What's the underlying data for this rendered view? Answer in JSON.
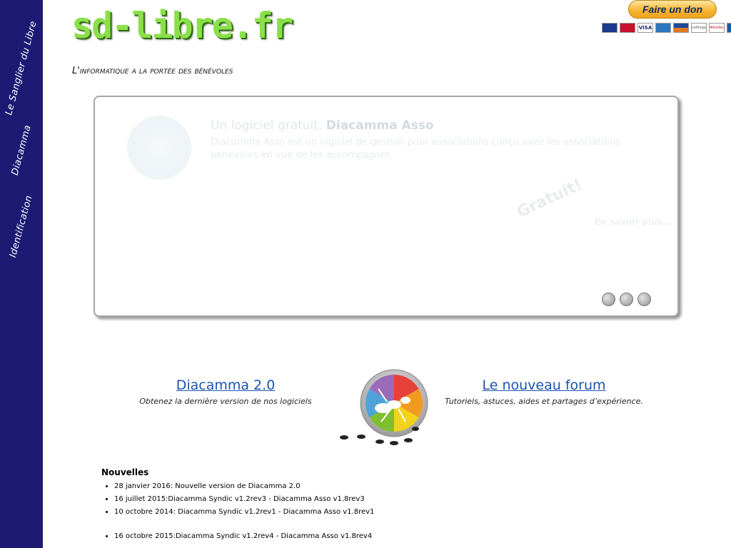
{
  "sidebar": {
    "items": [
      {
        "label": "Le Sanglier du Libre"
      },
      {
        "label": "Diacamma"
      },
      {
        "label": "Identification"
      }
    ]
  },
  "header": {
    "logo_text": "sd-libre.fr",
    "tagline": "L'informatique a la portée des bénévoles",
    "donate_label": "Faire un don",
    "card_icons": [
      "maestro-icon",
      "mastercard-icon",
      "visa-icon",
      "amex-icon",
      "aurore-icon",
      "cofinoga-icon",
      "4etoiles-icon",
      "cb-icon"
    ]
  },
  "slider": {
    "title_prefix": "Un logiciel gratuit,",
    "title_bold": "Diacamma Asso",
    "text": "Diacamma Asso est un logiciel de gestion pour associations conçu avec les associations bénévoles en vue de les accompagner.",
    "stamp": "Gratuit!",
    "more_label": "En savoir plus...",
    "dots": 3
  },
  "features": {
    "left": {
      "title": "Diacamma 2.0",
      "subtitle": "Obtenez la dernière version de nos logiciels"
    },
    "right": {
      "title": "Le nouveau forum",
      "subtitle": "Tutoriels, astuces, aides et partages d’expérience."
    }
  },
  "news": {
    "title": "Nouvelles",
    "items": [
      "28 janvier 2016: Nouvelle version de Diacamma 2.0",
      "16 juillet 2015:Diacamma Syndic v1.2rev3 - Diacamma Asso v1.8rev3",
      "10 octobre 2014: Diacamma Syndic v1.2rev1 - Diacamma Asso v1.8rev1"
    ],
    "items2": [
      "16 octobre 2015:Diacamma Syndic v1.2rev4 - Diacamma Asso v1.8rev4"
    ]
  },
  "colors": {
    "sidebar_bg": "#1c1a73",
    "logo_green": "#8be04a",
    "link_blue": "#1a53b0"
  }
}
